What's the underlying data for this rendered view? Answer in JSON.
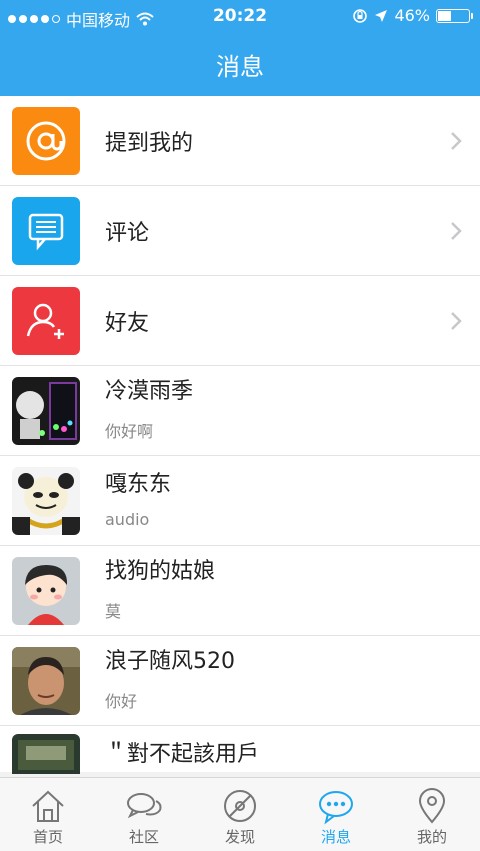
{
  "status_bar": {
    "carrier": "中国移动",
    "time": "20:22",
    "battery": "46%",
    "battery_level": 0.46
  },
  "header": {
    "title": "消息"
  },
  "menu": [
    {
      "label": "提到我的",
      "icon": "at-icon",
      "color": "#fb8a10"
    },
    {
      "label": "评论",
      "icon": "comment-icon",
      "color": "#19a6ec"
    },
    {
      "label": "好友",
      "icon": "add-friend-icon",
      "color": "#ee3840"
    }
  ],
  "messages": [
    {
      "name": "冷漠雨季",
      "preview": "你好啊"
    },
    {
      "name": "嘎东东",
      "preview": "audio"
    },
    {
      "name": "找狗的姑娘",
      "preview": "莫"
    },
    {
      "name": "浪子随风520",
      "preview": "你好"
    }
  ],
  "partial_message": {
    "name": "＂對不起該用戶"
  },
  "tabs": [
    {
      "label": "首页",
      "icon": "home-icon",
      "active": false
    },
    {
      "label": "社区",
      "icon": "community-icon",
      "active": false
    },
    {
      "label": "发现",
      "icon": "discover-icon",
      "active": false
    },
    {
      "label": "消息",
      "icon": "message-icon",
      "active": true
    },
    {
      "label": "我的",
      "icon": "profile-icon",
      "active": false
    }
  ],
  "colors": {
    "accent": "#35a7ee",
    "active_tab": "#1fa7ee"
  }
}
